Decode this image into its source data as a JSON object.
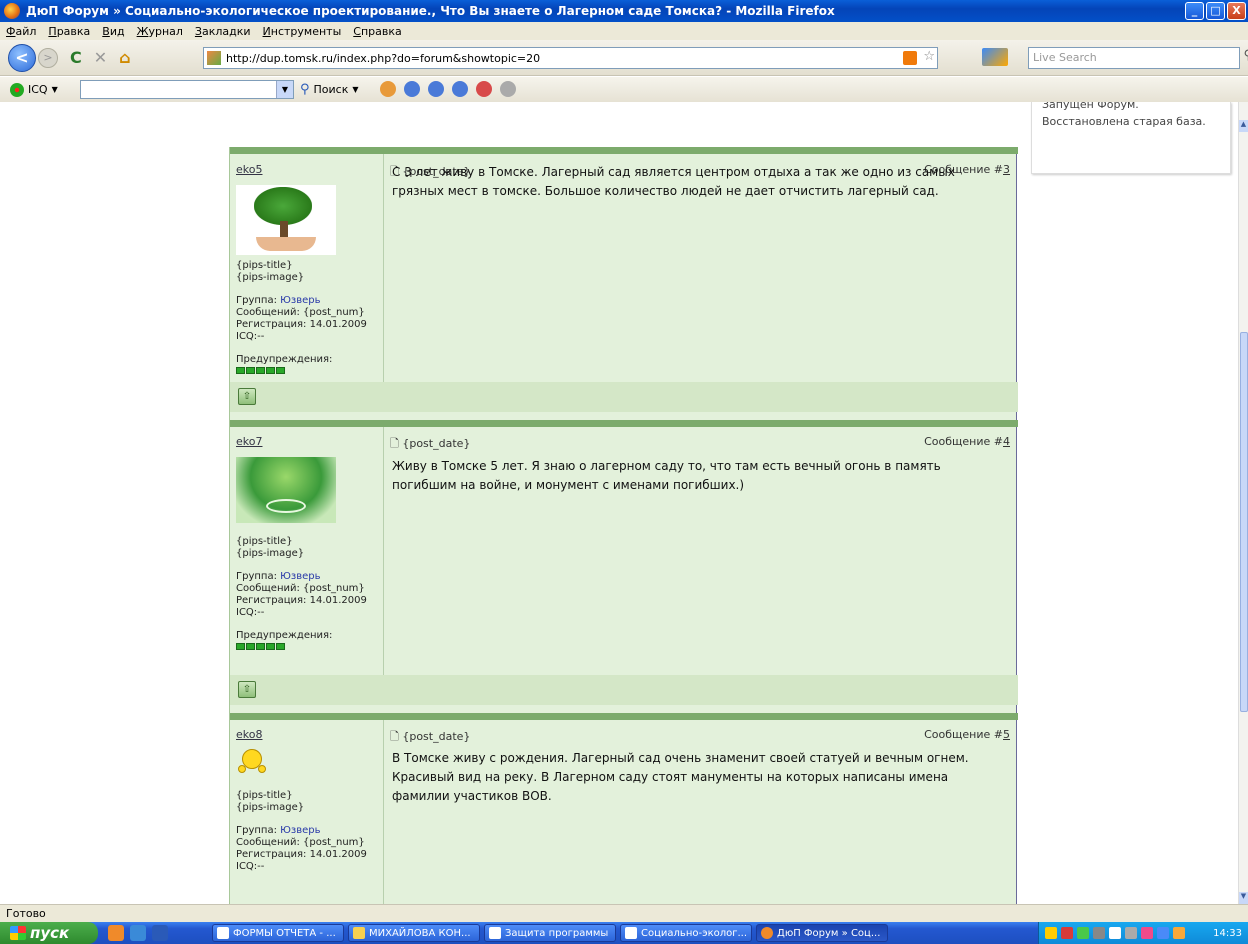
{
  "window": {
    "title": "ДюП Форум » Социально-экологическое проектирование., Что Вы знаете о Лагерном саде Томска? - Mozilla Firefox",
    "min": "_",
    "max": "□",
    "close": "X"
  },
  "menu": [
    "Файл",
    "Правка",
    "Вид",
    "Журнал",
    "Закладки",
    "Инструменты",
    "Справка"
  ],
  "nav": {
    "back": "<",
    "forward": ">",
    "reload": "C",
    "stop": "✕",
    "home": "⌂",
    "url": "http://dup.tomsk.ru/index.php?do=forum&showtopic=20",
    "search_placeholder": "Live Search"
  },
  "toolbar2": {
    "icq_label": "ICQ",
    "search_label": "Поиск"
  },
  "side_box": {
    "text": "Запущен Форум. Восстановлена старая база."
  },
  "posts": [
    {
      "author": "eko5",
      "date": "{post_date}",
      "msg_label": "Сообщение #",
      "msg_num": "3",
      "pips_title": "{pips-title}",
      "pips_image": "{pips-image}",
      "group_label": "Группа:",
      "group": "Юзверь",
      "posts_line": "Сообщений: {post_num}",
      "reg_line": "Регистрация: 14.01.2009",
      "icq_line": "ICQ:--",
      "warn_label": "Предупреждения:",
      "text": "С 3 лет живу в Томске. Лагерный сад является центром отдыха а так же одно из самых грязных мест в томске. Большое количество людей не дает отчистить лагерный сад.",
      "avatar": "tree-in-hand-avatar"
    },
    {
      "author": "eko7",
      "date": "{post_date}",
      "msg_label": "Сообщение #",
      "msg_num": "4",
      "pips_title": "{pips-title}",
      "pips_image": "{pips-image}",
      "group_label": "Группа:",
      "group": "Юзверь",
      "posts_line": "Сообщений: {post_num}",
      "reg_line": "Регистрация: 14.01.2009",
      "icq_line": "ICQ:--",
      "warn_label": "Предупреждения:",
      "text": "Живу в Томске 5 лет. Я знаю о лагерном саду то, что там есть вечный огонь в память погибшим на войне, и монумент с именами погибших.)",
      "avatar": "green-leaf-avatar"
    },
    {
      "author": "eko8",
      "date": "{post_date}",
      "msg_label": "Сообщение #",
      "msg_num": "5",
      "pips_title": "{pips-title}",
      "pips_image": "{pips-image}",
      "group_label": "Группа:",
      "group": "Юзверь",
      "posts_line": "Сообщений: {post_num}",
      "reg_line": "Регистрация: 14.01.2009",
      "icq_line": "ICQ:--",
      "text": "В Томске живу с рождения. Лагерный сад очень знаменит своей статуей и вечным огнем. Красивый вид на реку. В Лагерном саду стоят манументы на которых написаны имена фамилии участиков ВОВ.",
      "avatar": "smiley-avatar"
    }
  ],
  "status": "Готово",
  "taskbar": {
    "start": "пуск",
    "tasks": [
      "ФОРМЫ ОТЧЕТА - ...",
      "МИХАЙЛОВА КОН...",
      "Защита программы",
      "Социально-эколог...",
      "ДюП Форум » Соц..."
    ],
    "clock": "14:33"
  }
}
